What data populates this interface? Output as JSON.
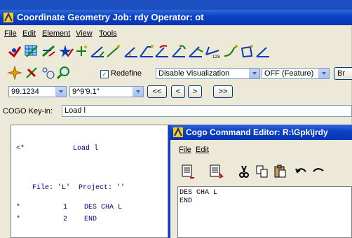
{
  "window": {
    "title": "Coordinate Geometry  Job: rdy  Operator: ot"
  },
  "menu": [
    "File",
    "Edit",
    "Element",
    "View",
    "Tools"
  ],
  "toolbar": {
    "redefine_label": "Redefine",
    "redefine_checked": true,
    "visualization": "Disable Visualization",
    "feature": "OFF (Feature)",
    "browse_label": "Br",
    "coord_value": "99.1234",
    "angle_value": "9^9'9.1\"",
    "nav": [
      "<<",
      "<",
      ">",
      ">>"
    ]
  },
  "keyin": {
    "label": "COGO Key-in:",
    "value": "Load l"
  },
  "output": {
    "lines": [
      {
        "marker": "<*",
        "text": "Load l"
      },
      {
        "marker": "",
        "text": "File: 'L'  Project: ''"
      },
      {
        "marker": "*",
        "num": "1",
        "text": "DES CHA L"
      },
      {
        "marker": "*",
        "num": "2",
        "text": "END"
      }
    ]
  },
  "editor": {
    "title": "Cogo Command Editor: R:\\Gpk\\jrdy",
    "menu": [
      "File",
      "Edit"
    ],
    "lines": [
      "DES CHA L",
      "END"
    ]
  },
  "colors": {
    "titlebar": "#0a3fc6",
    "face": "#ece9d8",
    "output_text": "#000080"
  }
}
